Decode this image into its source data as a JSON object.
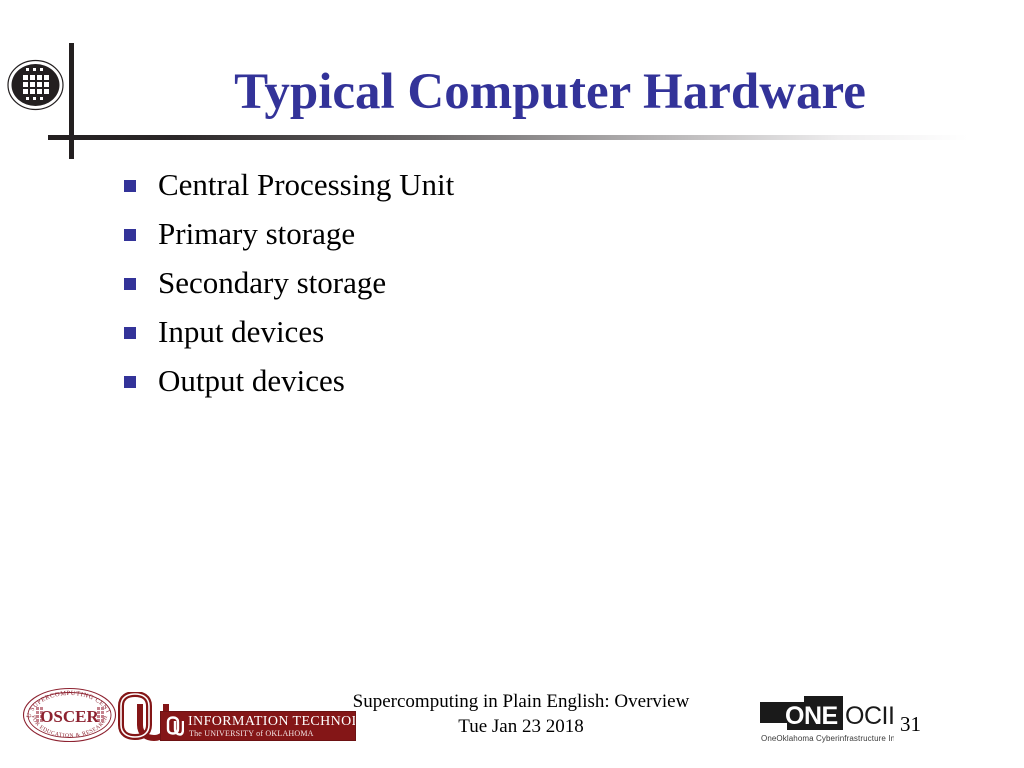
{
  "slide": {
    "title": "Typical Computer Hardware",
    "title_color": "#333399",
    "background_color": "#ffffff",
    "page_number": "31"
  },
  "header": {
    "logo_name": "oscer-oval-logo",
    "logo_alt": "OU Supercomputing Center for Education & Research",
    "divider_color": "#231f20"
  },
  "body": {
    "bullets": [
      {
        "label": "Central Processing Unit"
      },
      {
        "label": "Primary storage"
      },
      {
        "label": "Secondary storage"
      },
      {
        "label": "Input devices"
      },
      {
        "label": "Output devices"
      }
    ],
    "bullet_marker_color": "#333399",
    "text_color": "#000000"
  },
  "footer": {
    "oscer_logo": {
      "name": "oscer-seal-logo",
      "center_text": "OSCER",
      "arc_top_text": "OU SUPERCOMPUTING CENTER",
      "arc_bottom_text": "FOR EDUCATION & RESEARCH",
      "color": "#8d2230"
    },
    "ou_logo": {
      "name": "ou-interlocking-logo",
      "text": "OU",
      "color": "#841617"
    },
    "it_banner": {
      "line1": "INFORMATION TECHNOLOGY",
      "line2": "The UNIVERSITY of OKLAHOMA",
      "background": "#841617",
      "mark_text": "OU"
    },
    "center_line1": "Supercomputing in Plain English: Overview",
    "center_line2": "Tue Jan 23 2018",
    "oneocii_logo": {
      "name": "oneocii-logo",
      "mark_text": "ONE",
      "suffix_text": "OCII",
      "tagline": "OneOklahoma Cyberinfrastructure Initiative",
      "color": "#1a1a1a"
    }
  }
}
